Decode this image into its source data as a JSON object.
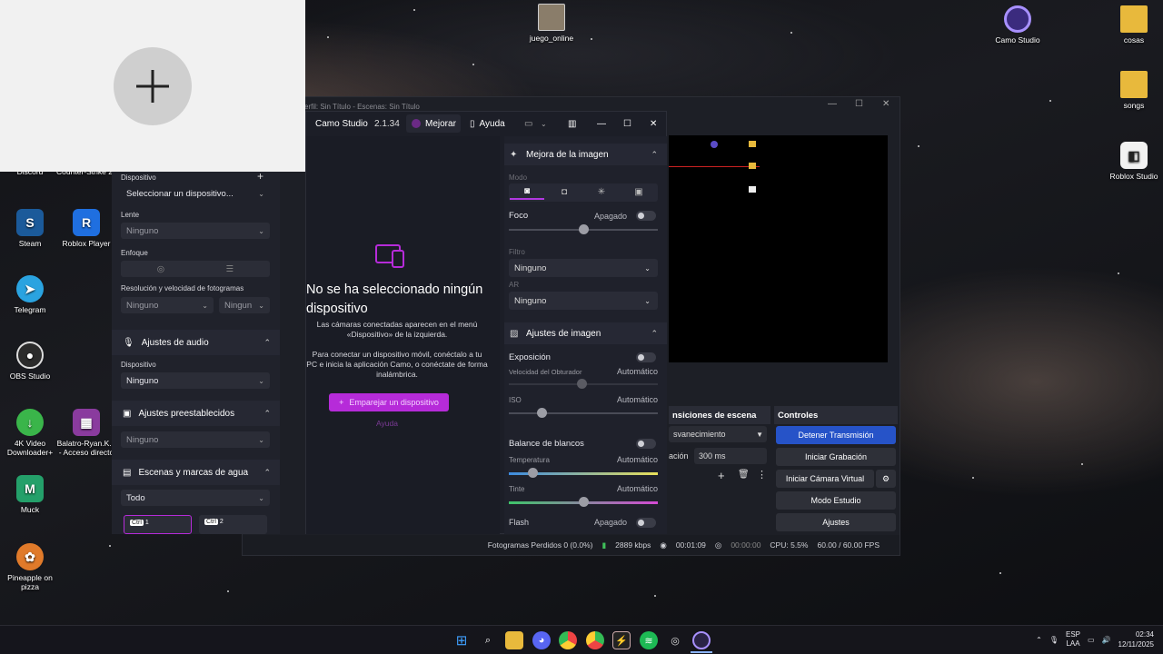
{
  "desktop": {
    "icons_left": [
      {
        "label": "Steam",
        "color": "#1b5a9a",
        "glyph": "S"
      },
      {
        "label": "Roblox Player",
        "color": "#1f6fe0",
        "glyph": "R"
      },
      {
        "label": "Telegram",
        "color": "#2aa3e0",
        "glyph": "➤"
      },
      {
        "label": "OBS Studio",
        "color": "#2b2b2b",
        "glyph": "●"
      },
      {
        "label": "4K Video Downloader+",
        "color": "#3ab54a",
        "glyph": "↓"
      },
      {
        "label": "Balatro-Ryan.K... - Acceso directo",
        "color": "#8a3b9e",
        "glyph": "▦"
      },
      {
        "label": "Muck",
        "color": "#24a06a",
        "glyph": "M"
      },
      {
        "label": "Pineapple on pizza",
        "color": "#e07a2a",
        "glyph": "✿"
      }
    ],
    "partial_labels": [
      "Discord",
      "Counter-Strike 2"
    ],
    "icons_top": [
      {
        "label": "juego_online",
        "color": "#8a7d6a"
      },
      {
        "label": "Camo Studio",
        "color": "#3b2b7e"
      },
      {
        "label": "cosas",
        "color": "#e8b93c"
      },
      {
        "label": "songs",
        "color": "#e8b93c"
      },
      {
        "label": "Roblox Studio",
        "color": "#f2f2f2"
      }
    ]
  },
  "obs": {
    "title": "erfil: Sin Título - Escenas: Sin Título",
    "transitions": {
      "header": "nsiciones de escena",
      "fade": "svanecimiento",
      "duration_label": "ación",
      "duration_value": "300 ms"
    },
    "controls": {
      "header": "Controles",
      "stop_stream": "Detener Transmisión",
      "start_recording": "Iniciar Grabación",
      "start_virtual_cam": "Iniciar Cámara Virtual",
      "studio_mode": "Modo Estudio",
      "settings": "Ajustes"
    },
    "status": {
      "dropped_frames": "Fotogramas Perdidos 0 (0.0%)",
      "bitrate": "2889 kbps",
      "stream_time": "00:01:09",
      "rec_time": "00:00:00",
      "cpu": "CPU: 5.5%",
      "fps": "60.00 / 60.00 FPS"
    }
  },
  "camo_left": {
    "device_label": "Dispositivo",
    "device_value": "Seleccionar un dispositivo...",
    "lens_label": "Lente",
    "lens_value": "Ninguno",
    "focus_label": "Enfoque",
    "resolution_label": "Resolución y velocidad de fotogramas",
    "resolution_value": "Ninguno",
    "fps_value": "Ningun",
    "audio_header": "Ajustes de audio",
    "audio_device_label": "Dispositivo",
    "audio_device_value": "Ninguno",
    "presets_header": "Ajustes preestablecidos",
    "presets_value": "Ninguno",
    "scenes_header": "Escenas y marcas de agua",
    "scenes_value": "Todo",
    "scene1_key": "Ctrl",
    "scene1_num": "1",
    "scene2_key": "Ctrl",
    "scene2_num": "2"
  },
  "camo_main": {
    "app_name": "Camo Studio",
    "version": "2.1.34",
    "upgrade": "Mejorar",
    "help": "Ayuda",
    "empty_title": "No se ha seleccionado ningún dispositivo",
    "empty_text1": "Las cámaras conectadas aparecen en el menú «Dispositivo» de la izquierda.",
    "empty_text2": "Para conectar un dispositivo móvil, conéctalo a tu PC e inicia la aplicación Camo, o conéctate de forma inalámbrica.",
    "pair_button": "Emparejar un dispositivo",
    "help_link": "Ayuda",
    "accent": "#b62bd9"
  },
  "camo_right": {
    "enhance_header": "Mejora de la imagen",
    "mode_label": "Modo",
    "focus_label": "Foco",
    "focus_value": "Apagado",
    "filter_label": "Filtro",
    "filter_value": "Ninguno",
    "ar_label": "AR",
    "ar_value": "Ninguno",
    "image_header": "Ajustes de imagen",
    "exposure_label": "Exposición",
    "shutter_label": "Velocidad del Obturador",
    "shutter_value": "Automático",
    "iso_label": "ISO",
    "iso_value": "Automático",
    "wb_label": "Balance de blancos",
    "temp_label": "Temperatura",
    "temp_value": "Automático",
    "tint_label": "Tinte",
    "tint_value": "Automático",
    "flash_label": "Flash",
    "flash_value": "Apagado"
  },
  "taskbar": {
    "lang": "ESP",
    "region": "LAA",
    "time": "02:34",
    "date": "12/11/2025"
  }
}
